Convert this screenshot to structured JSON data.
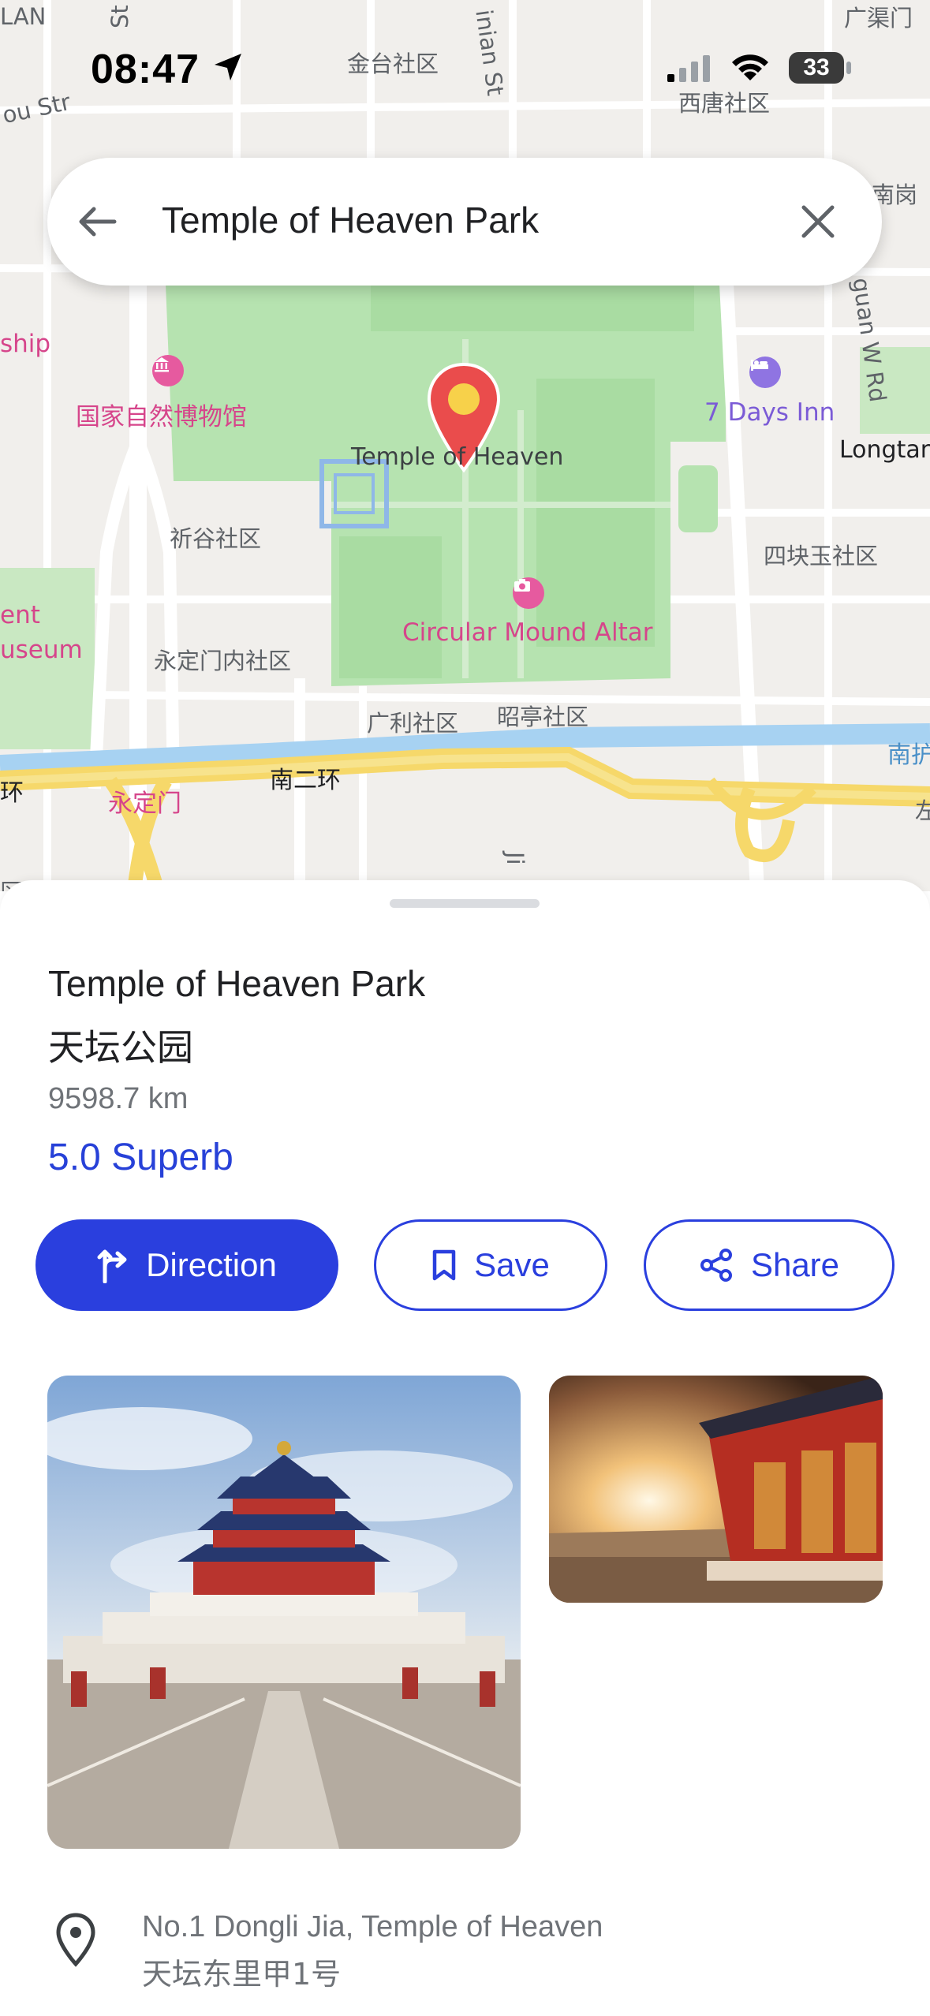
{
  "status_bar": {
    "time": "08:47",
    "battery": "33"
  },
  "search": {
    "query": "Temple of Heaven Park"
  },
  "map": {
    "labels": {
      "lan": "LAN",
      "st_top": "St",
      "jintai": "金台社区",
      "inian_st": "inian St",
      "guangqu": "广渠门",
      "xitang": "西唐社区",
      "ou_str": "ou Str",
      "nanguang": "南岗",
      "guan_w_rd": "guan W Rd",
      "ship": "ship",
      "museum_cn": "国家自然博物馆",
      "seven_days": "7 Days Inn",
      "temple": "Temple of Heaven",
      "longtan": "Longtan",
      "qigu": "祈谷社区",
      "sikuaiyu": "四块玉社区",
      "ent": "ent",
      "useum": "useum",
      "circular": "Circular Mound Altar",
      "yongdingmennei": "永定门内社区",
      "guangli": "广利社区",
      "zhaoting": "昭亭社区",
      "nanhu": "南护",
      "huan": "环",
      "nanerhuan": "南二环",
      "yongdingmen": "永定门",
      "ji": "Ji",
      "zuo": "左",
      "qu": "区"
    }
  },
  "place": {
    "name": "Temple of Heaven Park",
    "name_cn": "天坛公园",
    "distance": "9598.7 km",
    "rating": "5.0 Superb"
  },
  "actions": {
    "direction": "Direction",
    "save": "Save",
    "share": "Share"
  },
  "address": {
    "line1": "No.1 Dongli Jia, Temple of Heaven",
    "line2": "天坛东里甲1号"
  },
  "colors": {
    "accent": "#2a3fde",
    "pin": "#ea4c4c",
    "park": "#b6e3b0"
  }
}
